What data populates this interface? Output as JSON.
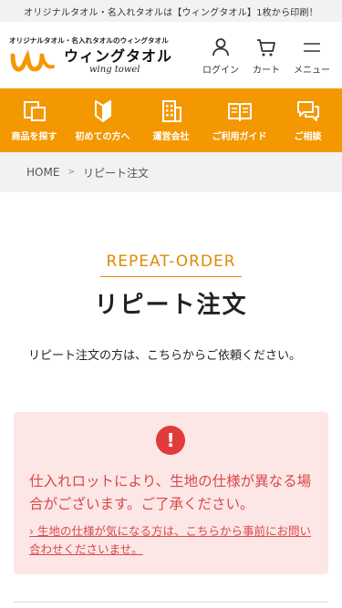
{
  "topbar": {
    "text": "オリジナルタオル・名入れタオルは【ウィングタオル】1枚から印刷！"
  },
  "logo": {
    "tagline": "オリジナルタオル・名入れタオルのウィングタオル",
    "name_jp": "ウィングタオル",
    "name_en": "wing towel",
    "brand_color": "#f39800"
  },
  "header_actions": [
    {
      "label": "ログイン",
      "icon": "user-icon"
    },
    {
      "label": "カート",
      "icon": "cart-icon"
    },
    {
      "label": "メニュー",
      "icon": "menu-icon"
    }
  ],
  "category_nav": [
    {
      "label": "商品を探す",
      "icon": "search-products-icon"
    },
    {
      "label": "初めての方へ",
      "icon": "beginner-mark-icon"
    },
    {
      "label": "運営会社",
      "icon": "building-icon"
    },
    {
      "label": "ご利用ガイド",
      "icon": "guide-book-icon"
    },
    {
      "label": "ご相談",
      "icon": "chat-icon"
    }
  ],
  "breadcrumb": {
    "home": "HOME",
    "separator": ">",
    "current": "リピート注文"
  },
  "main": {
    "subtitle": "REPEAT-ORDER",
    "title": "リピート注文",
    "intro": "リピート注文の方は、こちらからご依頼ください。"
  },
  "notice": {
    "icon_text": "!",
    "message": "仕入れロットにより、生地の仕様が異なる場合がございます。ご了承ください。",
    "link_text": "› 生地の仕様が気になる方は、こちらから事前にお問い合わせくださいませ。",
    "bg_color": "#fde6e6",
    "text_color": "#d94848"
  },
  "colors": {
    "accent": "#f39800",
    "alert": "#e23b3b"
  }
}
